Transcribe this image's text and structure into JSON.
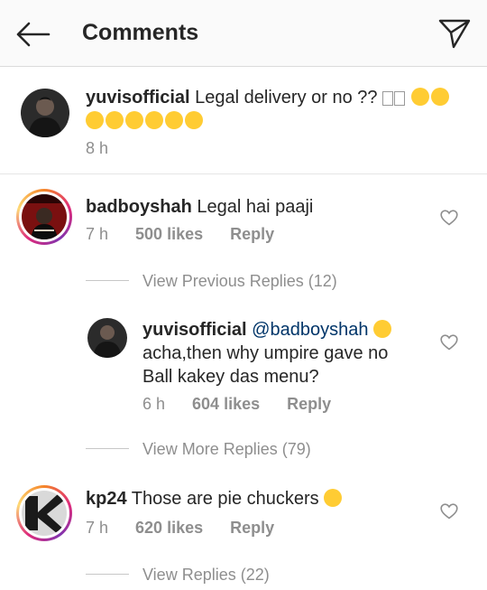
{
  "header": {
    "title": "Comments",
    "back_icon": "arrow-left-icon",
    "send_icon": "paper-plane-icon"
  },
  "caption": {
    "username": "yuvisofficial",
    "text": "Legal delivery or no ??",
    "time": "8 h"
  },
  "comments": [
    {
      "username": "badboyshah",
      "text": "Legal hai paaji",
      "time": "7 h",
      "likes": "500 likes",
      "reply": "Reply",
      "view_replies": "View Previous Replies (12)",
      "replies": [
        {
          "username": "yuvisofficial",
          "mention": "@badboyshah",
          "text_line1": "acha,then why umpire gave no",
          "text_line2": "Ball kakey das menu?",
          "time": "6 h",
          "likes": "604 likes",
          "reply": "Reply"
        }
      ],
      "view_more_replies": "View More Replies (79)"
    },
    {
      "username": "kp24",
      "text": "Those are pie chuckers",
      "time": "7 h",
      "likes": "620 likes",
      "reply": "Reply",
      "view_replies": "View Replies (22)"
    }
  ],
  "colors": {
    "text": "#262626",
    "muted": "#8e8e8e",
    "mention": "#003569",
    "emoji": "#ffcc33"
  }
}
